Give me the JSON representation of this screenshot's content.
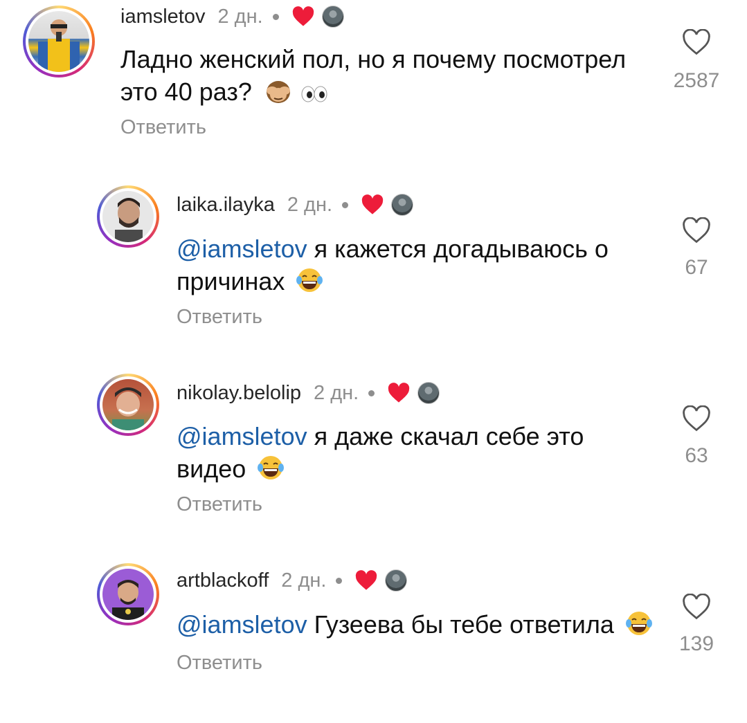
{
  "comments": [
    {
      "username": "iamsletov",
      "time": "2 дн.",
      "text": "Ладно женский пол, но я почему посмотрел это 40 раз?",
      "text_line1": "Ладно женский пол, но я почему посмотрел",
      "text_line2": "это 40 раз?",
      "mention": "",
      "emojis": [
        "see-no-evil-monkey",
        "eyes"
      ],
      "reply": "Ответить",
      "likes": "2587"
    },
    {
      "username": "laika.ilayka",
      "time": "2 дн.",
      "mention": "@iamsletov",
      "text_line1": " я кажется догадываюсь о",
      "text_line2": "причинах",
      "emojis": [
        "tears-of-joy"
      ],
      "reply": "Ответить",
      "likes": "67"
    },
    {
      "username": "nikolay.belolip",
      "time": "2 дн.",
      "mention": "@iamsletov",
      "text_line1": " я даже скачал себе это",
      "text_line2": "видео",
      "emojis": [
        "tears-of-joy"
      ],
      "reply": "Ответить",
      "likes": "63"
    },
    {
      "username": "artblackoff",
      "time": "2 дн.",
      "mention": "@iamsletov",
      "text_line1": " Гузеева бы тебе ответила",
      "emojis": [
        "tears-of-joy"
      ],
      "reply": "Ответить",
      "likes": "139"
    }
  ],
  "colors": {
    "mention": "#1d5fa7",
    "creator_heart": "#ed1c3a",
    "secondary_text": "#8e8e8e"
  }
}
